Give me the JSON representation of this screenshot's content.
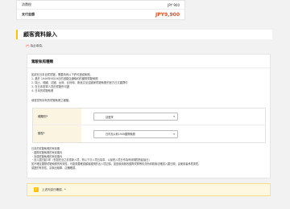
{
  "summary": {
    "tax_label": "消費稅",
    "tax_value": "JPY 900",
    "total_label": "支付金額",
    "total_value": "JPY9,900"
  },
  "section": {
    "title": "顧客資料錄入",
    "required_star": "(*)",
    "required_text": "為必填項。"
  },
  "license": {
    "title": "駕駛執照種類",
    "lines": [
      "如欲在日本自駕駕駛，需要持有以下許可證或執照。",
      "1. 基於 1949年9月19日的道路交通條約的國際駕駛執照",
      "2. 瑞士、德國、法國、台灣、比利時、斯洛文尼亞國家駕駛執照的官方日文翻譯件",
      "3. 在日本駐軍人員的駕駛許可證",
      "4. 日本的駕駛執照"
    ],
    "prompt": "填選您所持有的駕駛執照之種類。",
    "type_label": "種類別*",
    "type_value": "請選擇",
    "format_label": "類型*",
    "format_value": "日內瓦公約1949國際執照",
    "notes": [
      "日本的駕駛執照的有效期",
      "・國際駕駛執照的有效期內",
      "・本國駕駛執照的有效期內",
      "・自入國日起1年（但如在此之前重新入境，則以下次入境日為準，以最短入境日作為有效期間的起始日）",
      "如不確定國際駕駛執照的有效性，可能需要確認顧客護照的出入境記錄。如因使用無效國際駕照等情況而導致無法確認入國日期，由使用者承擔風險。",
      "認證的有效性，請與出租車、店舖確認。"
    ]
  },
  "confirm": {
    "label": "上述內容已確認。*"
  }
}
